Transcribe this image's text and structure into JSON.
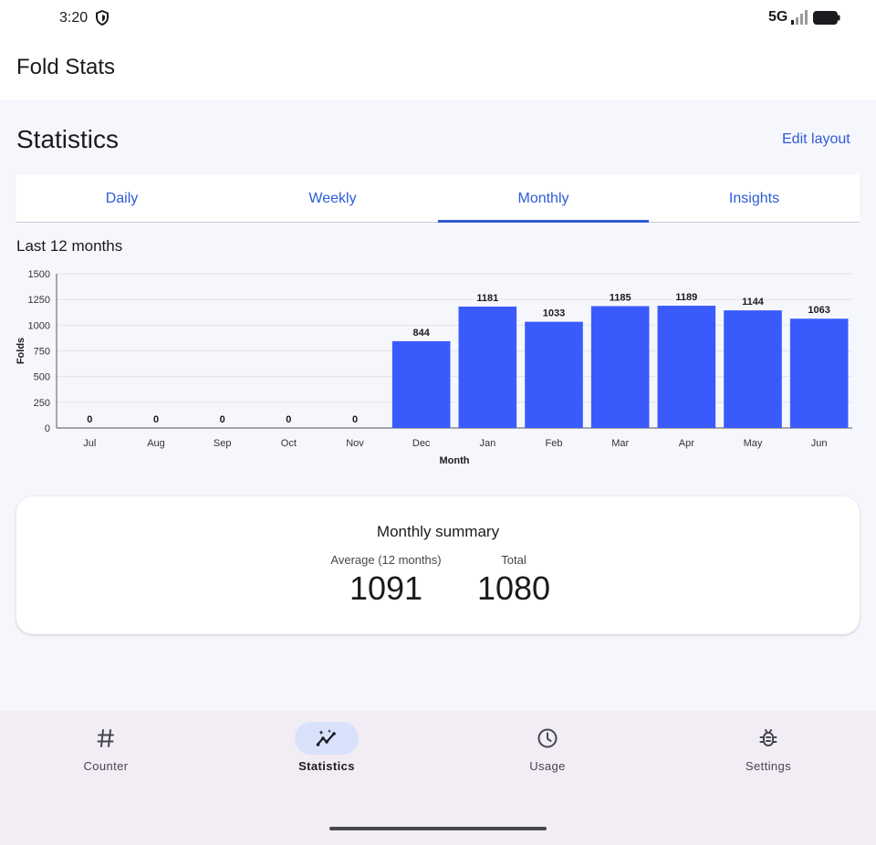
{
  "status_bar": {
    "time": "3:20",
    "network": "5G"
  },
  "app_bar": {
    "title": "Fold Stats"
  },
  "page": {
    "title": "Statistics",
    "edit_layout": "Edit layout"
  },
  "tabs": [
    {
      "label": "Daily",
      "active": false
    },
    {
      "label": "Weekly",
      "active": false
    },
    {
      "label": "Monthly",
      "active": true
    },
    {
      "label": "Insights",
      "active": false
    }
  ],
  "chart_title": "Last 12 months",
  "chart_data": {
    "type": "bar",
    "title": "Last 12 months",
    "categories": [
      "Jul",
      "Aug",
      "Sep",
      "Oct",
      "Nov",
      "Dec",
      "Jan",
      "Feb",
      "Mar",
      "Apr",
      "May",
      "Jun"
    ],
    "values": [
      0,
      0,
      0,
      0,
      0,
      844,
      1181,
      1033,
      1185,
      1189,
      1144,
      1063
    ],
    "xlabel": "Month",
    "ylabel": "Folds",
    "ylim": [
      0,
      1500
    ],
    "yticks": [
      0,
      250,
      500,
      750,
      1000,
      1250,
      1500
    ],
    "grid": true,
    "bar_color": "#3a5afc"
  },
  "summary": {
    "title": "Monthly summary",
    "average_label": "Average (12 months)",
    "average_value": "1091",
    "total_label": "Total",
    "total_value": "1080"
  },
  "bottom_nav": [
    {
      "label": "Counter",
      "icon": "hash-icon",
      "active": false
    },
    {
      "label": "Statistics",
      "icon": "insights-icon",
      "active": true
    },
    {
      "label": "Usage",
      "icon": "clock-icon",
      "active": false
    },
    {
      "label": "Settings",
      "icon": "bug-icon",
      "active": false
    }
  ],
  "colors": {
    "accent": "#2d5bd6",
    "bar": "#3a5afc",
    "nav_bg": "#f2ecf5",
    "active_pill": "#d9e2fb"
  }
}
